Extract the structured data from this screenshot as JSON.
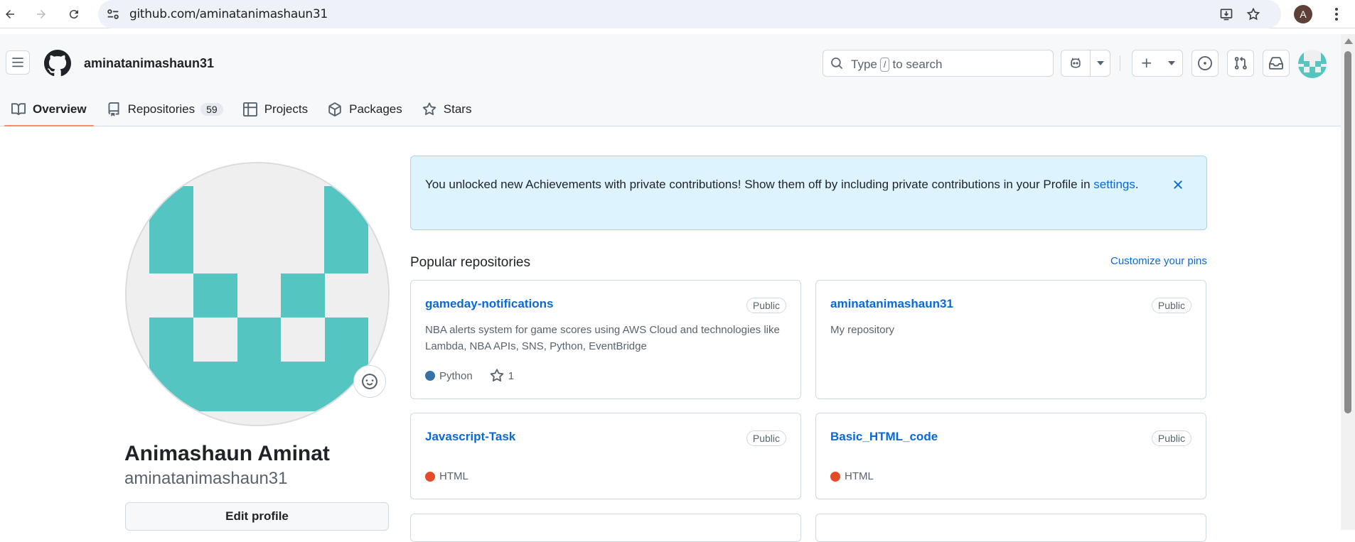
{
  "browser": {
    "url": "github.com/aminatanimashaun31",
    "profile_initial": "A"
  },
  "header": {
    "username": "aminatanimashaun31",
    "search": {
      "prefix": "Type",
      "key": "/",
      "suffix": "to search"
    }
  },
  "tabs": [
    {
      "label": "Overview",
      "icon": "book-icon",
      "active": true
    },
    {
      "label": "Repositories",
      "icon": "repo-icon",
      "count": "59"
    },
    {
      "label": "Projects",
      "icon": "table-icon"
    },
    {
      "label": "Packages",
      "icon": "package-icon"
    },
    {
      "label": "Stars",
      "icon": "star-icon"
    }
  ],
  "profile": {
    "name": "Animashaun Aminat",
    "login": "aminatanimashaun31",
    "edit_label": "Edit profile",
    "avatar_color": "#54c5c1"
  },
  "flash": {
    "message": "You unlocked new Achievements with private contributions! Show them off by including private contributions in your Profile in",
    "link": "settings",
    "end": "."
  },
  "popular": {
    "title": "Popular repositories",
    "customize": "Customize your pins",
    "repos": [
      {
        "name": "gameday-notifications",
        "visibility": "Public",
        "description": "NBA alerts system for game scores using AWS Cloud and technologies like Lambda, NBA APIs, SNS, Python, EventBridge",
        "language": "Python",
        "language_color": "#3572a5",
        "stars": "1"
      },
      {
        "name": "aminatanimashaun31",
        "visibility": "Public",
        "description": "My repository"
      },
      {
        "name": "Javascript-Task",
        "visibility": "Public",
        "language": "HTML",
        "language_color": "#e34c26"
      },
      {
        "name": "Basic_HTML_code",
        "visibility": "Public",
        "language": "HTML",
        "language_color": "#e34c26"
      }
    ]
  }
}
